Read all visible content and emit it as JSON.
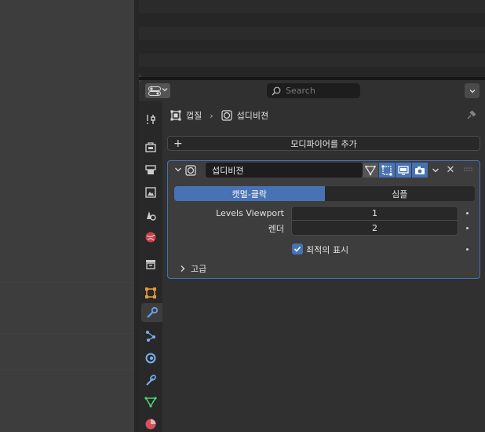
{
  "properties_header": {
    "search_placeholder": "Search"
  },
  "breadcrumb": {
    "object_name": "껍질",
    "modifier_name": "섭디비젼"
  },
  "add_modifier_label": "모디파이어를 추가",
  "modifier": {
    "name": "섭디비젼",
    "algorithms": [
      "캣멀-클락",
      "심플"
    ],
    "selected_algorithm": "캣멀-클락",
    "levels_viewport_label": "Levels Viewport",
    "levels_viewport_value": "1",
    "render_label": "렌더",
    "render_value": "2",
    "optimal_display_label": "최적의 표시",
    "optimal_display_checked": true,
    "advanced_label": "고급"
  },
  "colors": {
    "accent": "#4772b3",
    "panel_bg": "#3d3d3d",
    "field_bg": "#282828"
  },
  "icons": {
    "editor_type": "properties-editor-icon",
    "tabs": [
      "tool-icon",
      "render-icon",
      "output-icon",
      "view-layer-icon",
      "scene-icon",
      "world-icon",
      "collection-icon",
      "object-icon",
      "modifier-wrench-icon",
      "particles-icon",
      "physics-icon",
      "constraints-icon",
      "object-data-icon",
      "material-icon"
    ]
  }
}
